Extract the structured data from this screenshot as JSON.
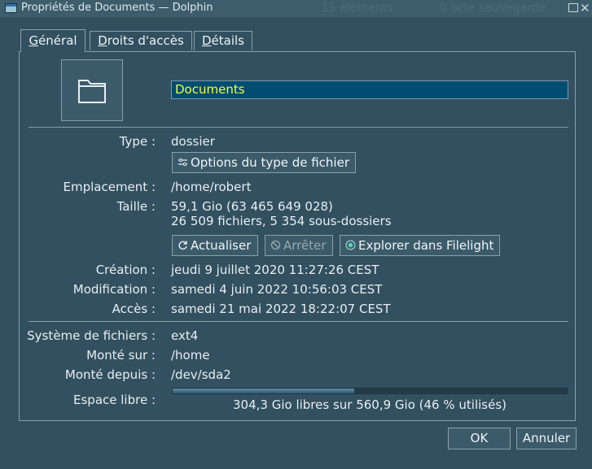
{
  "window": {
    "title": "Propriétés de Documents — Dolphin",
    "background_text_1": "15 éléments",
    "background_text_2": "0 octe sauvegarde"
  },
  "tabs": [
    {
      "label_underlined": "G",
      "label_rest": "énéral",
      "active": true
    },
    {
      "label_underlined": "D",
      "label_rest": "roits d'accès",
      "active": false
    },
    {
      "label_underlined": "D",
      "label_rest": "étails",
      "active": false
    }
  ],
  "name_field": {
    "value": "Documents"
  },
  "general": {
    "type_label": "Type :",
    "type_value": "dossier",
    "file_type_options_button": "Options du type de fichier",
    "location_label": "Emplacement :",
    "location_value": "/home/robert",
    "size_label": "Taille :",
    "size_value": "59,1 Gio (63 465 649 028)",
    "size_detail": "26 509 fichiers, 5 354 sous-dossiers",
    "refresh_button": "Actualiser",
    "stop_button": "Arrêter",
    "filelight_button": "Explorer dans Filelight",
    "created_label": "Création :",
    "created_value": "jeudi 9 juillet 2020 11:27:26 CEST",
    "modified_label": "Modification :",
    "modified_value": "samedi 4 juin 2022 10:56:03 CEST",
    "accessed_label": "Accès :",
    "accessed_value": "samedi 21 mai 2022 18:22:07 CEST",
    "filesystem_label": "Système de fichiers :",
    "filesystem_value": "ext4",
    "mounted_on_label": "Monté sur :",
    "mounted_on_value": "/home",
    "mounted_from_label": "Monté depuis :",
    "mounted_from_value": "/dev/sda2",
    "free_space_label": "Espace libre :",
    "free_space_text": "304,3 Gio libres sur 560,9 Gio (46 % utilisés)",
    "used_fraction": 0.46
  },
  "buttons": {
    "ok": "OK",
    "cancel": "Annuler"
  },
  "colors": {
    "accent_fill": "#2f5a73",
    "name_text": "#f3ff3c"
  }
}
